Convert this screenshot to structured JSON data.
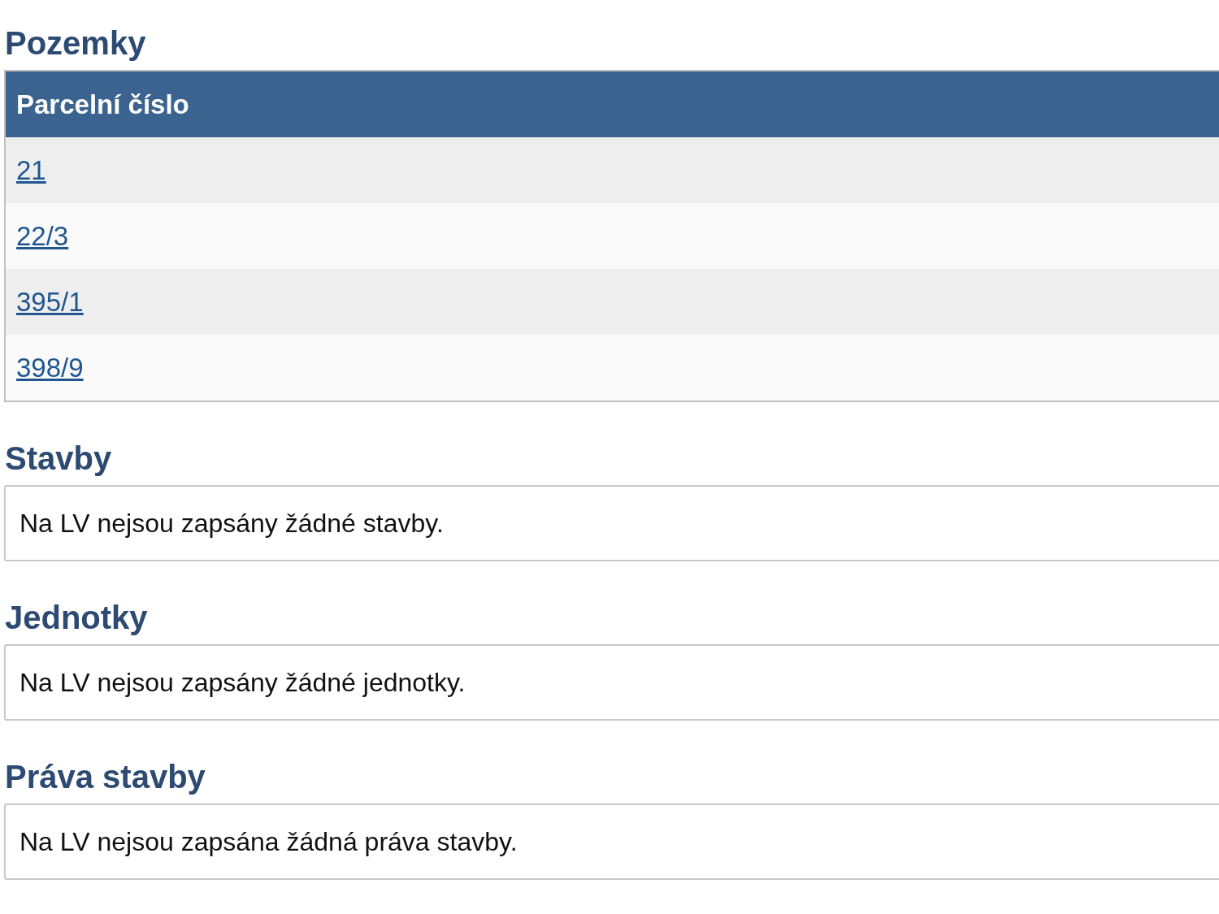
{
  "sections": [
    {
      "kind": "table",
      "title": "Pozemky",
      "columns": [
        "Parcelní číslo"
      ],
      "rows": [
        "21",
        "22/3",
        "395/1",
        "398/9"
      ]
    },
    {
      "kind": "note",
      "title": "Stavby",
      "text": "Na LV nejsou zapsány žádné stavby."
    },
    {
      "kind": "note",
      "title": "Jednotky",
      "text": "Na LV nejsou zapsány žádné jednotky."
    },
    {
      "kind": "note",
      "title": "Práva stavby",
      "text": "Na LV nejsou zapsána žádná práva stavby."
    }
  ]
}
